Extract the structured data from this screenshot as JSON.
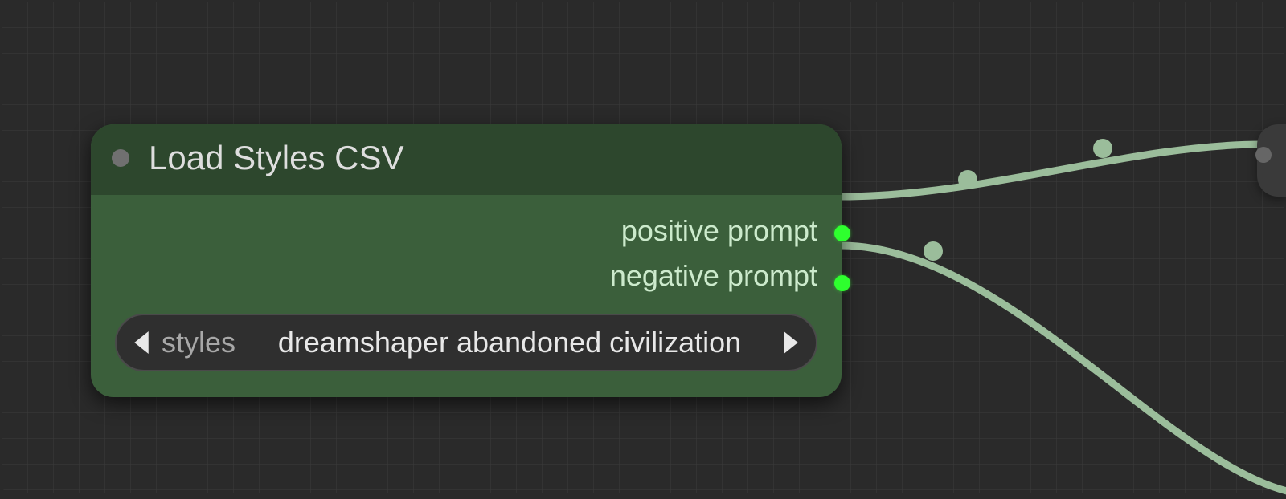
{
  "node": {
    "title": "Load Styles CSV",
    "outputs": [
      {
        "label": "positive prompt"
      },
      {
        "label": "negative prompt"
      }
    ],
    "widget": {
      "label": "styles",
      "value": "dreamshaper abandoned civilization"
    }
  }
}
